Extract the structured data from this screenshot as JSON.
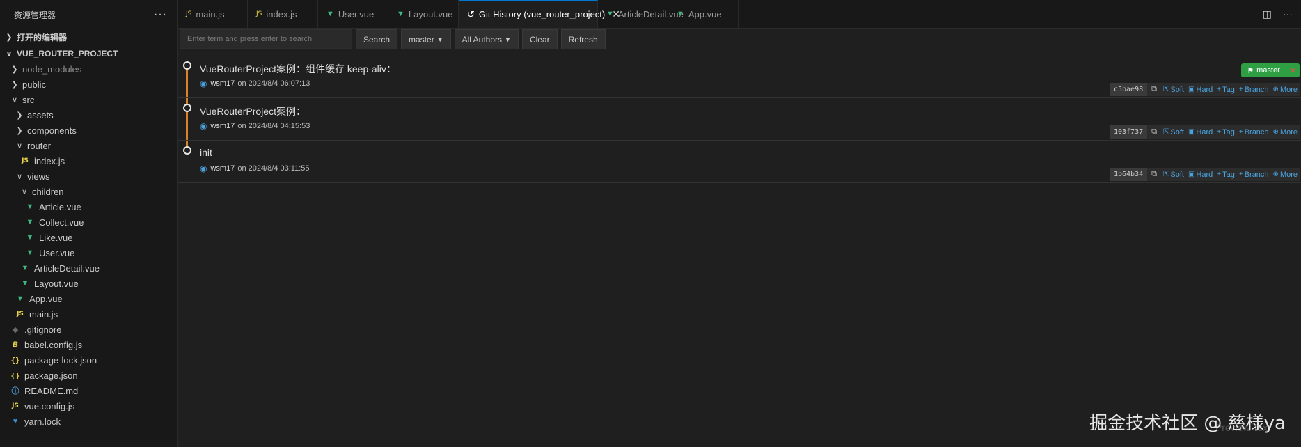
{
  "sidebar": {
    "title": "资源管理器",
    "more": "···",
    "open_editors": "打开的编辑器",
    "project": "VUE_ROUTER_PROJECT",
    "tree": [
      {
        "label": "node_modules",
        "depth": 0,
        "kind": "folder",
        "open": false,
        "dim": true
      },
      {
        "label": "public",
        "depth": 0,
        "kind": "folder",
        "open": false
      },
      {
        "label": "src",
        "depth": 0,
        "kind": "folder",
        "open": true
      },
      {
        "label": "assets",
        "depth": 1,
        "kind": "folder",
        "open": false
      },
      {
        "label": "components",
        "depth": 1,
        "kind": "folder",
        "open": false
      },
      {
        "label": "router",
        "depth": 1,
        "kind": "folder",
        "open": true
      },
      {
        "label": "index.js",
        "depth": 2,
        "kind": "js"
      },
      {
        "label": "views",
        "depth": 1,
        "kind": "folder",
        "open": true
      },
      {
        "label": "children",
        "depth": 2,
        "kind": "folder",
        "open": true
      },
      {
        "label": "Article.vue",
        "depth": 3,
        "kind": "vue"
      },
      {
        "label": "Collect.vue",
        "depth": 3,
        "kind": "vue"
      },
      {
        "label": "Like.vue",
        "depth": 3,
        "kind": "vue"
      },
      {
        "label": "User.vue",
        "depth": 3,
        "kind": "vue"
      },
      {
        "label": "ArticleDetail.vue",
        "depth": 2,
        "kind": "vue"
      },
      {
        "label": "Layout.vue",
        "depth": 2,
        "kind": "vue"
      },
      {
        "label": "App.vue",
        "depth": 1,
        "kind": "vue"
      },
      {
        "label": "main.js",
        "depth": 1,
        "kind": "js"
      },
      {
        "label": ".gitignore",
        "depth": 0,
        "kind": "git"
      },
      {
        "label": "babel.config.js",
        "depth": 0,
        "kind": "babel"
      },
      {
        "label": "package-lock.json",
        "depth": 0,
        "kind": "json"
      },
      {
        "label": "package.json",
        "depth": 0,
        "kind": "json"
      },
      {
        "label": "README.md",
        "depth": 0,
        "kind": "info"
      },
      {
        "label": "vue.config.js",
        "depth": 0,
        "kind": "js"
      },
      {
        "label": "yarn.lock",
        "depth": 0,
        "kind": "yarn"
      }
    ]
  },
  "tabs": [
    {
      "label": "main.js",
      "kind": "js",
      "active": false
    },
    {
      "label": "index.js",
      "kind": "js",
      "active": false
    },
    {
      "label": "User.vue",
      "kind": "vue",
      "active": false
    },
    {
      "label": "Layout.vue",
      "kind": "vue",
      "active": false
    },
    {
      "label": "Git History (vue_router_project)",
      "kind": "history",
      "active": true
    },
    {
      "label": "ArticleDetail.vue",
      "kind": "vue",
      "active": false
    },
    {
      "label": "App.vue",
      "kind": "vue",
      "active": false
    }
  ],
  "toolbar": {
    "search_placeholder": "Enter term and press enter to search",
    "search_label": "Search",
    "branch_label": "master",
    "authors_label": "All Authors",
    "clear_label": "Clear",
    "refresh_label": "Refresh"
  },
  "commits": [
    {
      "subject": "VueRouterProject案例：组件缓存 keep-aliv：",
      "author": "wsm17",
      "date": "on 2024/8/4 06:07:13",
      "hash": "c5bae98",
      "branch": "master"
    },
    {
      "subject": "VueRouterProject案例：",
      "author": "wsm17",
      "date": "on 2024/8/4 04:15:53",
      "hash": "103f737",
      "branch": null
    },
    {
      "subject": "init",
      "author": "wsm17",
      "date": "on 2024/8/4 03:11:55",
      "hash": "1b64b34",
      "branch": null
    }
  ],
  "commit_actions": {
    "soft": "Soft",
    "hard": "Hard",
    "tag": "Tag",
    "branch": "Branch",
    "more": "More"
  },
  "watermark": "掘金技术社区 @ 慈様ya",
  "faint_text": "Preview   Text",
  "colors": {
    "accent": "#0078d4",
    "graph": "#d9822b",
    "branch_badge": "#2ea043",
    "link": "#4aa3df",
    "vue": "#41b883",
    "js": "#e8d44d"
  }
}
